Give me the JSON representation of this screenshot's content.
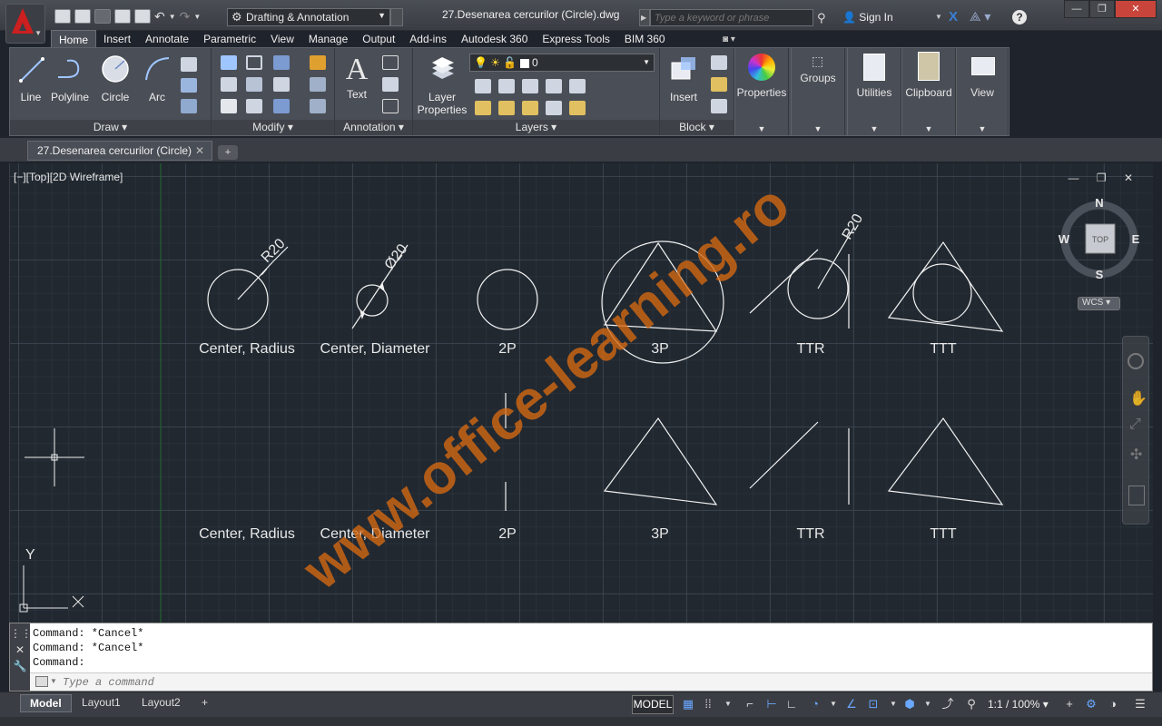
{
  "app": {
    "title": "27.Desenarea cercurilor (Circle).dwg",
    "workspace": "Drafting & Annotation",
    "search_placeholder": "Type a keyword or phrase",
    "sign_in": "Sign In"
  },
  "ribbon_tabs": [
    "Home",
    "Insert",
    "Annotate",
    "Parametric",
    "View",
    "Manage",
    "Output",
    "Add-ins",
    "Autodesk 360",
    "Express Tools",
    "BIM 360"
  ],
  "ribbon": {
    "draw": {
      "line": "Line",
      "polyline": "Polyline",
      "circle": "Circle",
      "arc": "Arc",
      "panel": "Draw"
    },
    "modify": {
      "panel": "Modify"
    },
    "annotation": {
      "text": "Text",
      "panel": "Annotation"
    },
    "layers": {
      "layer_props": "Layer",
      "layer_props2": "Properties",
      "layer_value": "0",
      "panel": "Layers"
    },
    "block": {
      "insert": "Insert",
      "panel": "Block"
    },
    "properties": "Properties",
    "groups": "Groups",
    "utilities": "Utilities",
    "clipboard": "Clipboard",
    "view": "View"
  },
  "file_tab": "27.Desenarea cercurilor (Circle)",
  "viewport": {
    "label": "[−][Top][2D Wireframe]",
    "compass": {
      "n": "N",
      "s": "S",
      "e": "E",
      "w": "W",
      "cube": "TOP"
    },
    "wcs": "WCS"
  },
  "drawing": {
    "dim_r20": "R20",
    "dim_d20": "Ø20",
    "dim_r20b": "R20",
    "row1": [
      "Center, Radius",
      "Center, Diameter",
      "2P",
      "3P",
      "TTR",
      "TTT"
    ],
    "row2": [
      "Center, Radius",
      "Center, Diameter",
      "2P",
      "3P",
      "TTR",
      "TTT"
    ],
    "ucs_x": "X",
    "ucs_y": "Y",
    "watermark": "www.office-learning.ro"
  },
  "command": {
    "history": [
      "Command: *Cancel*",
      "Command: *Cancel*",
      "Command:"
    ],
    "placeholder": "Type a command"
  },
  "status": {
    "layouts": [
      "Model",
      "Layout1",
      "Layout2"
    ],
    "model": "MODEL",
    "scale": "1:1 / 100%"
  },
  "colors": {
    "accent": "#3b7fd6",
    "watermark": "#d86a12",
    "canvas": "#212830"
  }
}
